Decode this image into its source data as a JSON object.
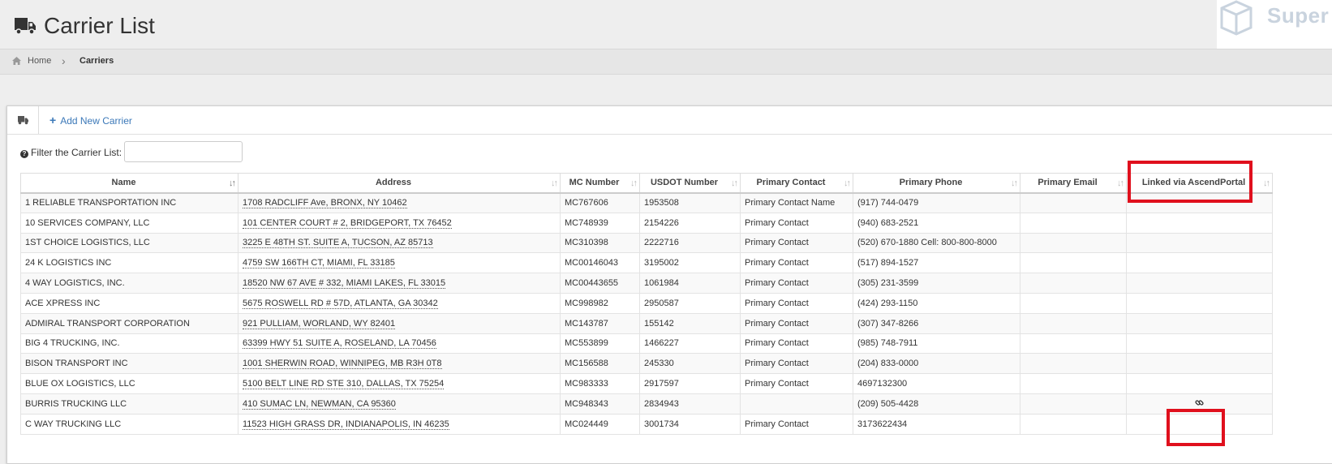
{
  "header": {
    "title": "Carrier List",
    "logo_text": "Super"
  },
  "breadcrumb": {
    "home": "Home",
    "separator": "›",
    "current": "Carriers"
  },
  "toolbar": {
    "add_label": "Add New Carrier",
    "add_icon": "plus-icon"
  },
  "filter": {
    "label": "Filter the Carrier List:",
    "value": "",
    "placeholder": ""
  },
  "table": {
    "columns": [
      "Name",
      "Address",
      "MC Number",
      "USDOT Number",
      "Primary Contact",
      "Primary Phone",
      "Primary Email",
      "Linked via AscendPortal"
    ],
    "rows": [
      {
        "name": "1 RELIABLE TRANSPORTATION INC",
        "address": "1708 RADCLIFF Ave, BRONX, NY 10462",
        "mc": "MC767606",
        "usdot": "1953508",
        "contact": "Primary Contact Name",
        "phone": "(917) 744-0479",
        "email": "",
        "linked": false
      },
      {
        "name": "10 SERVICES COMPANY, LLC",
        "address": "101 CENTER COURT # 2, BRIDGEPORT, TX 76452",
        "mc": "MC748939",
        "usdot": "2154226",
        "contact": "Primary Contact",
        "phone": "(940) 683-2521",
        "email": "",
        "linked": false
      },
      {
        "name": "1ST CHOICE LOGISTICS, LLC",
        "address": "3225 E 48TH ST. SUITE A, TUCSON, AZ 85713",
        "mc": "MC310398",
        "usdot": "2222716",
        "contact": "Primary Contact",
        "phone": "(520) 670-1880 Cell: 800-800-8000",
        "email": "",
        "linked": false
      },
      {
        "name": "24 K LOGISTICS INC",
        "address": "4759 SW 166TH CT, MIAMI, FL 33185",
        "mc": "MC00146043",
        "usdot": "3195002",
        "contact": "Primary Contact",
        "phone": "(517) 894-1527",
        "email": "",
        "linked": false
      },
      {
        "name": "4 WAY LOGISTICS, INC.",
        "address": "18520 NW 67 AVE # 332, MIAMI LAKES, FL 33015",
        "mc": "MC00443655",
        "usdot": "1061984",
        "contact": "Primary Contact",
        "phone": "(305) 231-3599",
        "email": "",
        "linked": false
      },
      {
        "name": "ACE XPRESS INC",
        "address": "5675 ROSWELL RD # 57D, ATLANTA, GA 30342",
        "mc": "MC998982",
        "usdot": "2950587",
        "contact": "Primary Contact",
        "phone": "(424) 293-1150",
        "email": "",
        "linked": false
      },
      {
        "name": "ADMIRAL TRANSPORT CORPORATION",
        "address": "921 PULLIAM, WORLAND, WY 82401",
        "mc": "MC143787",
        "usdot": "155142",
        "contact": "Primary Contact",
        "phone": "(307) 347-8266",
        "email": "",
        "linked": false
      },
      {
        "name": "BIG 4 TRUCKING, INC.",
        "address": "63399 HWY 51 SUITE A, ROSELAND, LA 70456",
        "mc": "MC553899",
        "usdot": "1466227",
        "contact": "Primary Contact",
        "phone": "(985) 748-7911",
        "email": "",
        "linked": false
      },
      {
        "name": "BISON TRANSPORT INC",
        "address": "1001 SHERWIN ROAD, WINNIPEG, MB R3H 0T8",
        "mc": "MC156588",
        "usdot": "245330",
        "contact": "Primary Contact",
        "phone": "(204) 833-0000",
        "email": "",
        "linked": false
      },
      {
        "name": "BLUE OX LOGISTICS, LLC",
        "address": "5100 BELT LINE RD STE 310, DALLAS, TX 75254",
        "mc": "MC983333",
        "usdot": "2917597",
        "contact": "Primary Contact",
        "phone": "4697132300",
        "email": "",
        "linked": false
      },
      {
        "name": "BURRIS TRUCKING LLC",
        "address": "410 SUMAC LN, NEWMAN, CA 95360",
        "mc": "MC948343",
        "usdot": "2834943",
        "contact": "",
        "phone": "(209) 505-4428",
        "email": "",
        "linked": true
      },
      {
        "name": "C WAY TRUCKING LLC",
        "address": "11523 HIGH GRASS DR, INDIANAPOLIS, IN 46235",
        "mc": "MC024449",
        "usdot": "3001734",
        "contact": "Primary Contact",
        "phone": "3173622434",
        "email": "",
        "linked": false
      }
    ]
  },
  "icons": {
    "header": "truck-icon",
    "breadcrumb": "home-icon",
    "linked": "link-icon",
    "filter": "question-circle-icon",
    "sort": "sort-icon"
  },
  "colors": {
    "highlight": "#e0101d",
    "link": "#3b78b8",
    "background": "#eeeeee"
  }
}
